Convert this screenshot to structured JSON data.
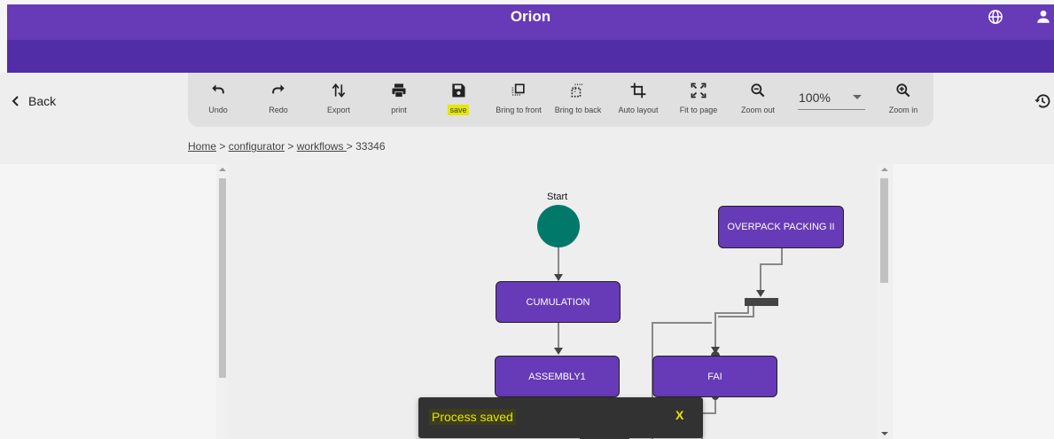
{
  "app": {
    "title": "Orion"
  },
  "nav": {
    "back_label": "Back"
  },
  "toolbar": {
    "tools": [
      {
        "label": "Undo",
        "icon": "undo-icon"
      },
      {
        "label": "Redo",
        "icon": "redo-icon"
      },
      {
        "label": "Export",
        "icon": "export-icon"
      },
      {
        "label": "print",
        "icon": "print-icon"
      },
      {
        "label": "save",
        "icon": "save-icon"
      },
      {
        "label": "Bring to front",
        "icon": "bring-to-front-icon"
      },
      {
        "label": "Bring to back",
        "icon": "bring-to-back-icon"
      },
      {
        "label": "Auto layout",
        "icon": "crop-icon"
      },
      {
        "label": "Fit to page",
        "icon": "fit-to-page-icon"
      },
      {
        "label": "Zoom out",
        "icon": "zoom-out-icon"
      },
      {
        "label": "Zoom in",
        "icon": "zoom-in-icon"
      }
    ],
    "zoom_value": "100%"
  },
  "breadcrumb": {
    "home": "Home",
    "sep1": " > ",
    "configurator": "configurator",
    "sep2": " > ",
    "workflows": "workflows ",
    "sep3": "> ",
    "id": "33346"
  },
  "diagram": {
    "start_label": "Start",
    "nodes": {
      "cumulation": "CUMULATION",
      "assembly1": "ASSEMBLY1",
      "overpack": "OVERPACK PACKING II",
      "fai": "FAI"
    }
  },
  "snackbar": {
    "message": "Process saved",
    "close_label": "X"
  },
  "colors": {
    "primary": "#673ab7",
    "primary_dark": "#512da8",
    "start_node": "#00796b",
    "highlight": "#e6e600"
  }
}
